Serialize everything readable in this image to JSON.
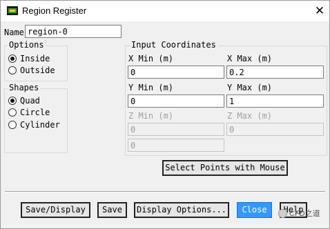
{
  "window": {
    "title": "Region Register",
    "icon": "fluent-app-icon",
    "close_icon": "close-icon"
  },
  "name_field": {
    "label": "Name",
    "value": "region-0"
  },
  "options": {
    "title": "Options",
    "items": [
      {
        "label": "Inside",
        "selected": true
      },
      {
        "label": "Outside",
        "selected": false
      }
    ]
  },
  "shapes": {
    "title": "Shapes",
    "items": [
      {
        "label": "Quad",
        "selected": true
      },
      {
        "label": "Circle",
        "selected": false
      },
      {
        "label": "Cylinder",
        "selected": false
      }
    ]
  },
  "coords": {
    "title": "Input Coordinates",
    "x_min": {
      "label": "X Min (m)",
      "value": "0"
    },
    "x_max": {
      "label": "X Max (m)",
      "value": "0.2"
    },
    "y_min": {
      "label": "Y Min (m)",
      "value": "0"
    },
    "y_max": {
      "label": "Y Max (m)",
      "value": "1"
    },
    "z_min": {
      "label": "Z Min (m)",
      "value": "0"
    },
    "z_max": {
      "label": "Z Max (m)",
      "value": "0"
    },
    "radius": {
      "value": "0"
    },
    "select_points_label": "Select Points with Mouse"
  },
  "buttons": {
    "save_display": "Save/Display",
    "save": "Save",
    "display_options": "Display Options...",
    "close": "Close",
    "help": "Help"
  },
  "watermark": {
    "text": "CFD之道",
    "icon": "wechat-icon"
  }
}
